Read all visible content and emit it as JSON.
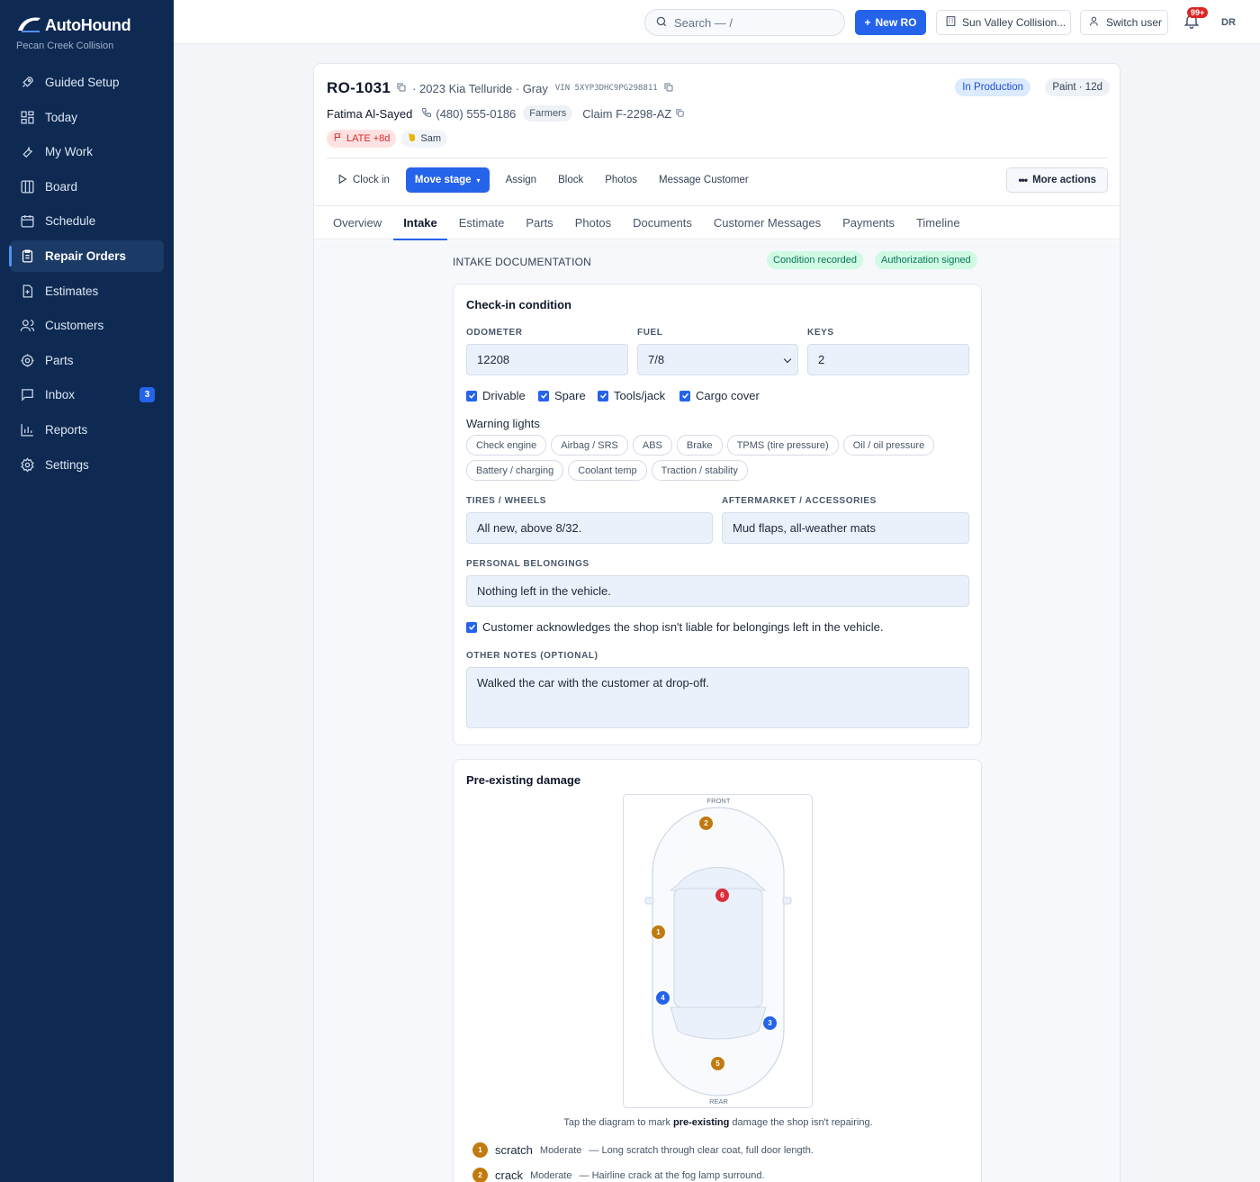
{
  "brand": {
    "name": "AutoHound",
    "shop": "Pecan Creek Collision"
  },
  "nav": [
    {
      "label": "Guided Setup",
      "icon": "rocket-icon"
    },
    {
      "label": "Today",
      "icon": "dashboard-icon"
    },
    {
      "label": "My Work",
      "icon": "wrench-icon"
    },
    {
      "label": "Board",
      "icon": "columns-icon"
    },
    {
      "label": "Schedule",
      "icon": "calendar-icon"
    },
    {
      "label": "Repair Orders",
      "icon": "clipboard-icon",
      "active": true
    },
    {
      "label": "Estimates",
      "icon": "file-icon"
    },
    {
      "label": "Customers",
      "icon": "users-icon"
    },
    {
      "label": "Parts",
      "icon": "gear-part-icon"
    },
    {
      "label": "Inbox",
      "icon": "message-icon",
      "badge": "3"
    },
    {
      "label": "Reports",
      "icon": "bar-chart-icon"
    },
    {
      "label": "Settings",
      "icon": "settings-icon"
    }
  ],
  "topbar": {
    "search_placeholder": "Search — /",
    "new_ro": "New RO",
    "shop_switcher": "Sun Valley Collision...",
    "switch_user": "Switch user",
    "notif_count": "99+",
    "avatar": "DR"
  },
  "ro": {
    "number": "RO-1031",
    "vehicle": "· 2023 Kia Telluride · Gray",
    "vin": "VIN 5XYP3DHC9PG298811",
    "status": "In Production",
    "stage": "Paint · 12d",
    "customer": "Fatima Al-Sayed",
    "phone": "(480) 555-0186",
    "insurer": "Farmers",
    "claim": "Claim F-2298-AZ",
    "late": "LATE +8d",
    "tech": "Sam"
  },
  "actions": {
    "clock_in": "Clock in",
    "move_stage": "Move stage",
    "assign": "Assign",
    "block": "Block",
    "photos": "Photos",
    "message": "Message Customer",
    "more": "More actions"
  },
  "tabs": [
    "Overview",
    "Intake",
    "Estimate",
    "Parts",
    "Photos",
    "Documents",
    "Customer Messages",
    "Payments",
    "Timeline"
  ],
  "active_tab": "Intake",
  "intake": {
    "title": "INTAKE DOCUMENTATION",
    "chip_condition": "Condition recorded",
    "chip_auth": "Authorization signed",
    "checkin": {
      "title": "Check-in condition",
      "odometer_label": "ODOMETER",
      "odometer": "12208",
      "fuel_label": "FUEL",
      "fuel": "7/8",
      "keys_label": "KEYS",
      "keys": "2",
      "checks": [
        "Drivable",
        "Spare",
        "Tools/jack",
        "Cargo cover"
      ],
      "warning_title": "Warning lights",
      "warning_lights": [
        "Check engine",
        "Airbag / SRS",
        "ABS",
        "Brake",
        "TPMS (tire pressure)",
        "Oil / oil pressure",
        "Battery / charging",
        "Coolant temp",
        "Traction / stability"
      ],
      "tires_label": "TIRES / WHEELS",
      "tires": "All new, above 8/32.",
      "aftermarket_label": "AFTERMARKET / ACCESSORIES",
      "aftermarket": "Mud flaps, all-weather mats",
      "belongings_label": "PERSONAL BELONGINGS",
      "belongings": "Nothing left in the vehicle.",
      "ack": "Customer acknowledges the shop isn't liable for belongings left in the vehicle.",
      "notes_label": "OTHER NOTES (OPTIONAL)",
      "notes": "Walked the car with the customer at drop-off."
    },
    "damage": {
      "title": "Pre-existing damage",
      "front": "FRONT",
      "rear": "REAR",
      "hint_pre": "Tap the diagram to mark ",
      "hint_bold": "pre-existing",
      "hint_post": " damage the shop isn't repairing.",
      "markers": [
        "1",
        "2",
        "3",
        "4",
        "5",
        "6"
      ],
      "items": [
        {
          "n": "1",
          "type": "scratch",
          "severity": "Moderate",
          "desc": "— Long scratch through clear coat, full door length."
        },
        {
          "n": "2",
          "type": "crack",
          "severity": "Moderate",
          "desc": "— Hairline crack at the fog lamp surround."
        }
      ]
    }
  }
}
